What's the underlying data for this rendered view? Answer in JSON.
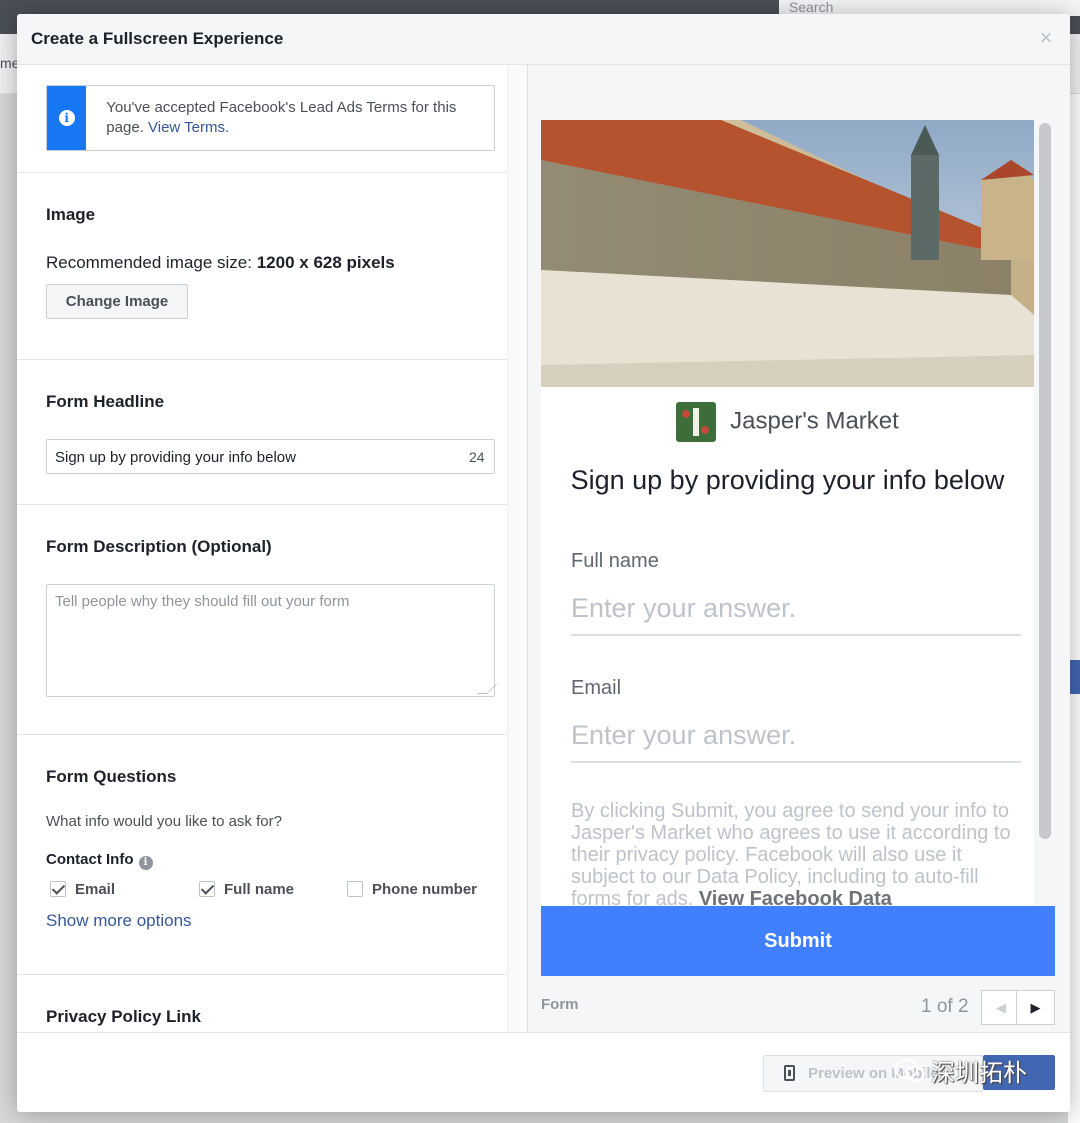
{
  "background": {
    "search_placeholder": "Search",
    "left_fragment": "me"
  },
  "modal": {
    "title": "Create a Fullscreen Experience",
    "close_label": "×"
  },
  "terms": {
    "text": "You've accepted Facebook's Lead Ads Terms for this page.",
    "link": "View Terms."
  },
  "image_section": {
    "title": "Image",
    "size_prefix": "Recommended image size: ",
    "size_value": "1200 x 628 pixels",
    "button": "Change Image"
  },
  "headline_section": {
    "title": "Form Headline",
    "value": "Sign up by providing your info below",
    "char_count": "24"
  },
  "description_section": {
    "title": "Form Description (Optional)",
    "placeholder": "Tell people why they should fill out your form"
  },
  "questions_section": {
    "title": "Form Questions",
    "subtitle": "What info would you like to ask for?",
    "contact_info": "Contact Info",
    "options": [
      {
        "label": "Email",
        "checked": true
      },
      {
        "label": "Full name",
        "checked": true
      },
      {
        "label": "Phone number",
        "checked": false
      }
    ],
    "show_more": "Show more options"
  },
  "privacy_section": {
    "title": "Privacy Policy Link"
  },
  "preview": {
    "brand_name": "Jasper's Market",
    "headline": "Sign up by providing your info below",
    "fields": [
      {
        "label": "Full name",
        "placeholder": "Enter your answer."
      },
      {
        "label": "Email",
        "placeholder": "Enter your answer."
      }
    ],
    "consent_text": "By clicking Submit, you agree to send your info to Jasper's Market who agrees to use it according to their privacy policy. Facebook will also use it subject to our Data Policy, including to auto-fill forms for ads. ",
    "consent_link": "View Facebook Data",
    "submit_label": "Submit",
    "footer_label": "Form",
    "pager_text": "1 of 2"
  },
  "footer": {
    "preview_button": "Preview on Mobile",
    "watermark": "深圳拓朴"
  },
  "colors": {
    "accent": "#4080ff",
    "info_blue": "#1877f2",
    "link": "#365899"
  }
}
